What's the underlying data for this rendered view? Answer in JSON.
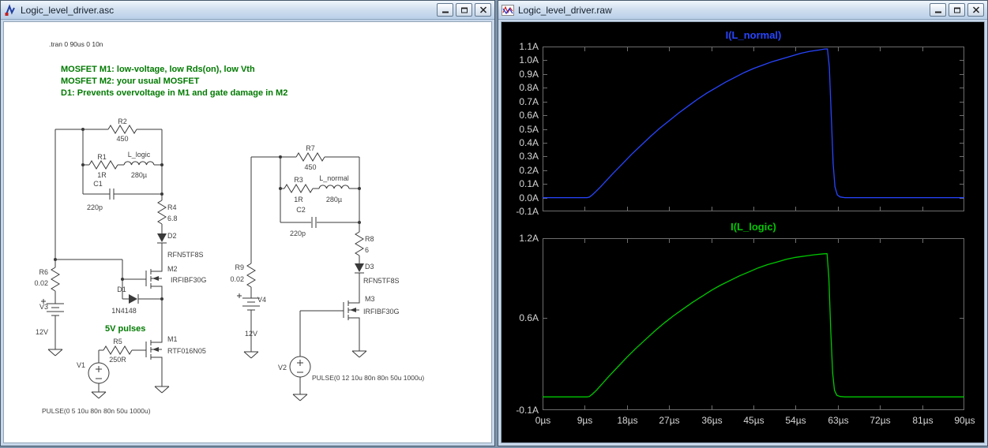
{
  "schematic_window": {
    "title": "Logic_level_driver.asc",
    "directive": ".tran 0 90us 0 10n",
    "comments": {
      "line1": "MOSFET M1: low-voltage, low Rds(on), low Vth",
      "line2": "MOSFET M2: your usual MOSFET",
      "line3": "D1: Prevents overvoltage in M1 and gate damage in M2",
      "pulses_note": "5V pulses"
    },
    "components": {
      "R1": {
        "name": "R1",
        "value": "1R"
      },
      "R2": {
        "name": "R2",
        "value": "450"
      },
      "R3": {
        "name": "R3",
        "value": "1R"
      },
      "R4": {
        "name": "R4",
        "value": "6.8"
      },
      "R5": {
        "name": "R5",
        "value": "250R"
      },
      "R6": {
        "name": "R6",
        "value": "0.02"
      },
      "R7": {
        "name": "R7",
        "value": "450"
      },
      "R8": {
        "name": "R8",
        "value": "6"
      },
      "R9": {
        "name": "R9",
        "value": "0.02"
      },
      "C1": {
        "name": "C1",
        "value": "220p"
      },
      "C2": {
        "name": "C2",
        "value": "220p"
      },
      "L_logic": {
        "name": "L_logic",
        "value": "280µ"
      },
      "L_normal": {
        "name": "L_normal",
        "value": "280µ"
      },
      "D1": {
        "name": "D1",
        "value": "1N4148"
      },
      "D2": {
        "name": "D2",
        "value": "RFN5TF8S"
      },
      "D3": {
        "name": "D3",
        "value": "RFN5TF8S"
      },
      "M1": {
        "name": "M1",
        "value": "RTF016N05"
      },
      "M2": {
        "name": "M2",
        "value": "IRFIBF30G"
      },
      "M3": {
        "name": "M3",
        "value": "IRFIBF30G"
      },
      "V1": {
        "name": "V1",
        "value": "PULSE(0 5 10u 80n 80n 50u 1000u)"
      },
      "V2": {
        "name": "V2",
        "value": "PULSE(0 12 10u 80n 80n 50u 1000u)"
      },
      "V3": {
        "name": "V3",
        "value": "12V"
      },
      "V4": {
        "name": "V4",
        "value": "12V"
      }
    }
  },
  "waveform_window": {
    "title": "Logic_level_driver.raw"
  },
  "chart_data": [
    {
      "type": "line",
      "title": "I(L_normal)",
      "color": "#2845ff",
      "x_unit": "µs",
      "y_unit": "A",
      "xlim": [
        0,
        90
      ],
      "ylim": [
        -0.1,
        1.1
      ],
      "background": "#000000",
      "grid": false,
      "yticks": [
        {
          "v": 1.1,
          "label": "1.1A"
        },
        {
          "v": 1.0,
          "label": "1.0A"
        },
        {
          "v": 0.9,
          "label": "0.9A"
        },
        {
          "v": 0.8,
          "label": "0.8A"
        },
        {
          "v": 0.7,
          "label": "0.7A"
        },
        {
          "v": 0.6,
          "label": "0.6A"
        },
        {
          "v": 0.5,
          "label": "0.5A"
        },
        {
          "v": 0.4,
          "label": "0.4A"
        },
        {
          "v": 0.3,
          "label": "0.3A"
        },
        {
          "v": 0.2,
          "label": "0.2A"
        },
        {
          "v": 0.1,
          "label": "0.1A"
        },
        {
          "v": 0.0,
          "label": "0.0A"
        },
        {
          "v": -0.1,
          "label": "-0.1A"
        }
      ],
      "xticks": [
        {
          "v": 0,
          "label": "0µs"
        },
        {
          "v": 9,
          "label": "9µs"
        },
        {
          "v": 18,
          "label": "18µs"
        },
        {
          "v": 27,
          "label": "27µs"
        },
        {
          "v": 36,
          "label": "36µs"
        },
        {
          "v": 45,
          "label": "45µs"
        },
        {
          "v": 54,
          "label": "54µs"
        },
        {
          "v": 63,
          "label": "63µs"
        },
        {
          "v": 72,
          "label": "72µs"
        },
        {
          "v": 81,
          "label": "81µs"
        },
        {
          "v": 90,
          "label": "90µs"
        }
      ],
      "x": [
        0,
        9.5,
        10,
        10.6,
        11.4,
        12.4,
        13.5,
        15,
        17,
        19,
        21,
        23,
        25,
        27,
        29,
        31,
        33,
        35,
        37,
        39,
        41,
        43,
        45,
        47,
        49,
        51,
        53,
        55,
        57,
        59,
        60.2,
        60.8,
        61.2,
        61.6,
        62,
        62.4,
        62.9,
        63.5,
        64.5,
        90
      ],
      "y": [
        0,
        0,
        0.004,
        0.02,
        0.045,
        0.08,
        0.12,
        0.175,
        0.245,
        0.315,
        0.38,
        0.445,
        0.505,
        0.56,
        0.615,
        0.665,
        0.715,
        0.76,
        0.8,
        0.84,
        0.875,
        0.91,
        0.94,
        0.965,
        0.99,
        1.01,
        1.03,
        1.05,
        1.065,
        1.075,
        1.082,
        1.083,
        0.95,
        0.6,
        0.25,
        0.08,
        0.02,
        0.005,
        0,
        0
      ]
    },
    {
      "type": "line",
      "title": "I(L_logic)",
      "color": "#00c800",
      "x_unit": "µs",
      "y_unit": "A",
      "xlim": [
        0,
        90
      ],
      "ylim": [
        -0.1,
        1.2
      ],
      "background": "#000000",
      "grid": false,
      "yticks": [
        {
          "v": 1.2,
          "label": "1.2A"
        },
        {
          "v": 0.6,
          "label": "0.6A"
        },
        {
          "v": -0.1,
          "label": "-0.1A"
        }
      ],
      "xticks": [
        {
          "v": 0,
          "label": "0µs"
        },
        {
          "v": 9,
          "label": "9µs"
        },
        {
          "v": 18,
          "label": "18µs"
        },
        {
          "v": 27,
          "label": "27µs"
        },
        {
          "v": 36,
          "label": "36µs"
        },
        {
          "v": 45,
          "label": "45µs"
        },
        {
          "v": 54,
          "label": "54µs"
        },
        {
          "v": 63,
          "label": "63µs"
        },
        {
          "v": 72,
          "label": "72µs"
        },
        {
          "v": 81,
          "label": "81µs"
        },
        {
          "v": 90,
          "label": "90µs"
        }
      ],
      "x": [
        0,
        9.5,
        10,
        10.6,
        11.5,
        12.5,
        14,
        16,
        18,
        20,
        22,
        24,
        26,
        28,
        30,
        32,
        34,
        36,
        38,
        40,
        42,
        44,
        46,
        48,
        50,
        52,
        54,
        56,
        58,
        60,
        60.7,
        61.1,
        61.5,
        61.9,
        62.3,
        62.8,
        63.5,
        64.5,
        90
      ],
      "y": [
        0,
        0,
        0.004,
        0.02,
        0.05,
        0.09,
        0.15,
        0.225,
        0.3,
        0.37,
        0.435,
        0.5,
        0.56,
        0.615,
        0.665,
        0.715,
        0.76,
        0.805,
        0.845,
        0.88,
        0.915,
        0.945,
        0.975,
        1.0,
        1.02,
        1.04,
        1.055,
        1.065,
        1.075,
        1.082,
        1.083,
        0.9,
        0.5,
        0.18,
        0.05,
        0.012,
        0.003,
        0,
        0
      ]
    }
  ]
}
